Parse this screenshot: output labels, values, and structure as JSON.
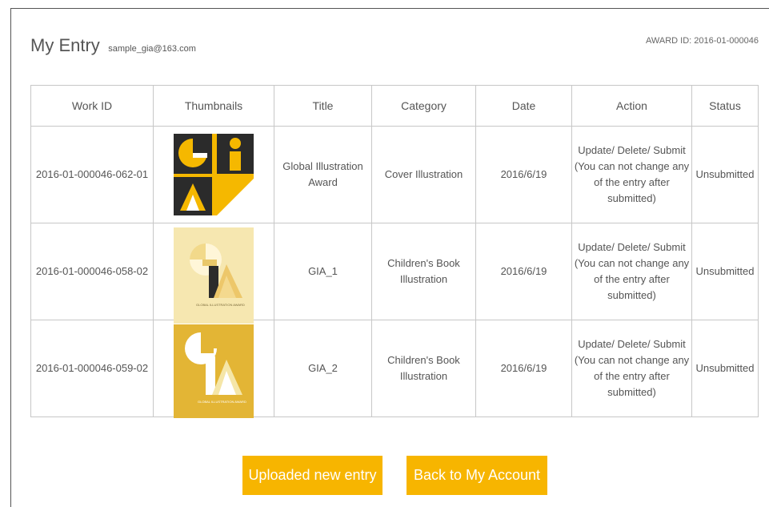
{
  "header": {
    "title": "My Entry",
    "email": "sample_gia@163.com",
    "award_id": "AWARD ID: 2016-01-000046"
  },
  "table": {
    "columns": [
      "Work ID",
      "Thumbnails",
      "Title",
      "Category",
      "Date",
      "Action",
      "Status"
    ],
    "rows": [
      {
        "work_id": "2016-01-000046-062-01",
        "thumbnail": "black-yellow-gia-logo-artwork",
        "title": "Global Illustration Award",
        "category": "Cover Illustration",
        "date": "2016/6/19",
        "action": "Update/ Delete/ Submit (You can not change any of the entry after submitted)",
        "status": "Unsubmitted"
      },
      {
        "work_id": "2016-01-000046-058-02",
        "thumbnail": "pale-yellow-gia-poster",
        "title": "GIA_1",
        "category": "Children's Book Illustration",
        "date": "2016/6/19",
        "action": "Update/ Delete/ Submit (You can not change any of the entry after submitted)",
        "status": "Unsubmitted"
      },
      {
        "work_id": "2016-01-000046-059-02",
        "thumbnail": "gold-gia-poster",
        "title": "GIA_2",
        "category": "Children's Book Illustration",
        "date": "2016/6/19",
        "action": "Update/ Delete/ Submit (You can not change any of the entry after submitted)",
        "status": "Unsubmitted"
      }
    ]
  },
  "thumb_text": {
    "poster": "GLOBAL ILLUSTRATION AWARD"
  },
  "buttons": {
    "upload": "Uploaded new entry",
    "back": "Back to My Account"
  },
  "colors": {
    "accent": "#f7b500",
    "thumb_dark": "#2b2b2b",
    "thumb_yellow": "#f5b800",
    "poster_pale": "#f6e7b0",
    "poster_gold": "#e3b535"
  }
}
